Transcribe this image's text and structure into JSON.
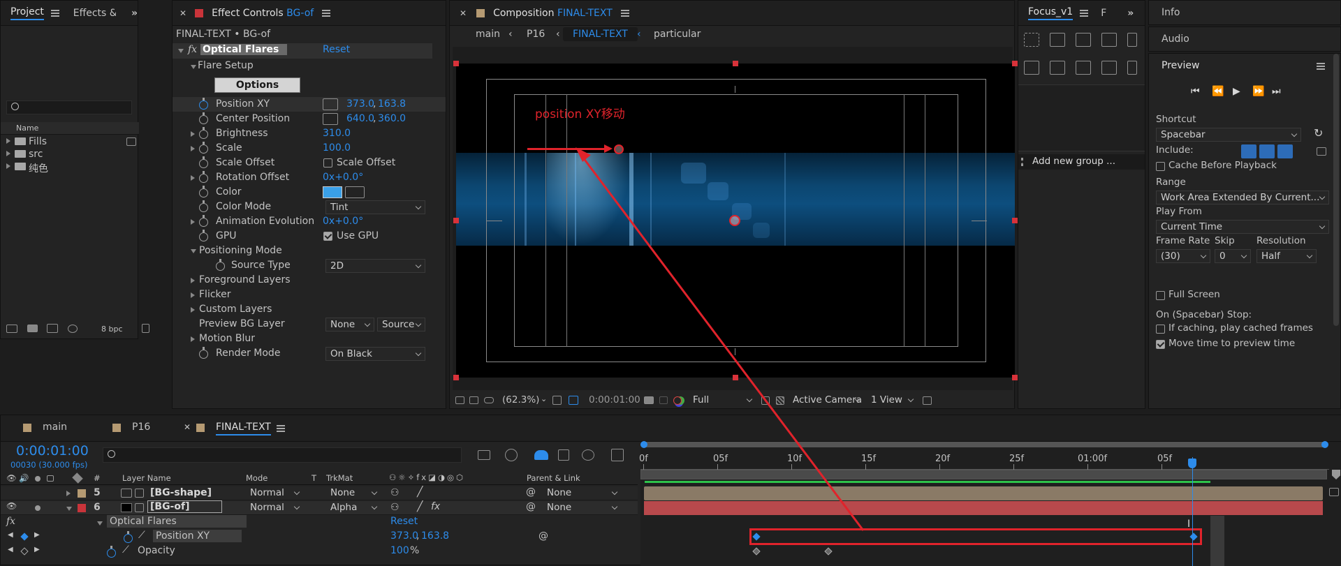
{
  "project": {
    "tab": "Project",
    "tab2": "Effects & Pre",
    "search_placeholder": "",
    "col_name": "Name",
    "items": [
      "Fills",
      "src",
      "纯色"
    ],
    "bpc": "8 bpc"
  },
  "effect_controls": {
    "tab_prefix": "Effect Controls",
    "tab_layer": "BG-of",
    "subtitle": "FINAL-TEXT • BG-of",
    "fx": "fx",
    "effect_name": "Optical Flares",
    "reset": "Reset",
    "flare_setup": "Flare Setup",
    "options_btn": "Options",
    "props": [
      {
        "name": "Position XY",
        "v1": "373.0",
        "v2": "163.8",
        "kind": "point"
      },
      {
        "name": "Center Position",
        "v1": "640.0",
        "v2": "360.0",
        "kind": "point"
      },
      {
        "name": "Brightness",
        "value": "310.0"
      },
      {
        "name": "Scale",
        "value": "100.0"
      },
      {
        "name": "Scale Offset",
        "check_label": "Scale Offset"
      },
      {
        "name": "Rotation Offset",
        "value": "0x+0.0°"
      },
      {
        "name": "Color"
      },
      {
        "name": "Color Mode",
        "select": "Tint"
      },
      {
        "name": "Animation Evolution",
        "value": "0x+0.0°"
      },
      {
        "name": "GPU",
        "check_label": "Use GPU"
      }
    ],
    "positioning_mode": "Positioning Mode",
    "source_type": "Source Type",
    "source_type_value": "2D",
    "foreground_layers": "Foreground Layers",
    "flicker": "Flicker",
    "custom_layers": "Custom Layers",
    "preview_bg": "Preview BG Layer",
    "preview_bg_v1": "None",
    "preview_bg_v2": "Source",
    "motion_blur": "Motion Blur",
    "render_mode": "Render Mode",
    "render_mode_value": "On Black"
  },
  "composition": {
    "tab_prefix": "Composition",
    "tab_name": "FINAL-TEXT",
    "crumbs": [
      "main",
      "P16",
      "FINAL-TEXT",
      "particular"
    ],
    "annotation": "position XY移动",
    "zoom": "(62.3%)",
    "timecode": "0:00:01:00",
    "quality": "Full",
    "camera": "Active Camera",
    "views": "1 View"
  },
  "focus": {
    "tab": "Focus_v1",
    "tab2": "F",
    "add_group": "Add new group ..."
  },
  "right": {
    "info": "Info",
    "audio": "Audio",
    "preview": "Preview",
    "shortcut_label": "Shortcut",
    "shortcut_value": "Spacebar",
    "include": "Include:",
    "cache_before": "Cache Before Playback",
    "range_label": "Range",
    "range_value": "Work Area Extended By Current...",
    "play_from_label": "Play From",
    "play_from_value": "Current Time",
    "frame_rate_label": "Frame Rate",
    "skip_label": "Skip",
    "resolution_label": "Resolution",
    "frame_rate_value": "(30)",
    "skip_value": "0",
    "resolution_value": "Half",
    "full_screen": "Full Screen",
    "on_stop": "On (Spacebar) Stop:",
    "if_caching": "If caching, play cached frames",
    "move_time": "Move time to preview time"
  },
  "timeline": {
    "tabs": [
      "main",
      "P16",
      "FINAL-TEXT"
    ],
    "timecode": "0:00:01:00",
    "fps": "00030 (30.000 fps)",
    "headers": {
      "num": "#",
      "layer_name": "Layer Name",
      "mode": "Mode",
      "t": "T",
      "trkmat": "TrkMat",
      "parent": "Parent & Link"
    },
    "layers": [
      {
        "num": "5",
        "name": "[BG-shape]",
        "mode": "Normal",
        "trkmat": "None",
        "parent": "None",
        "color": "#b59a72"
      },
      {
        "num": "6",
        "name": "[BG-of]",
        "mode": "Normal",
        "trkmat": "Alpha",
        "parent": "None",
        "color": "#c9343a"
      }
    ],
    "effect": "Optical Flares",
    "effect_reset": "Reset",
    "fx": "fx",
    "pos_label": "Position XY",
    "pos_v1": "373.0",
    "pos_v2": "163.8",
    "opacity_label": "Opacity",
    "opacity_value": "100",
    "opacity_unit": "%",
    "ruler": [
      "0f",
      "05f",
      "10f",
      "15f",
      "20f",
      "25f",
      "01:00f",
      "05f"
    ]
  },
  "colors": {
    "accent": "#2d8ceb",
    "annotation": "#e0232b",
    "layer5": "#b59a72",
    "layer6": "#c9343a",
    "workarea": "#2ec24a"
  }
}
